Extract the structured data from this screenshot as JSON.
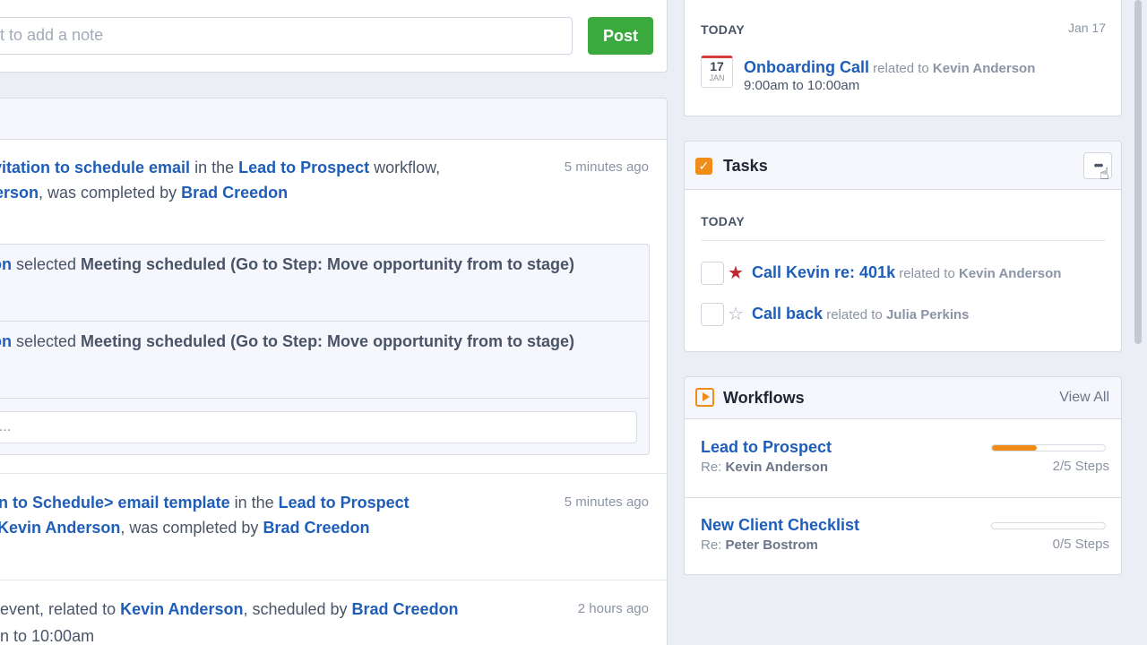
{
  "composer": {
    "placeholder_text": "ct to add a note",
    "post_label": "Post"
  },
  "feed": {
    "entry1": {
      "line1": {
        "link1": "vitation to schedule email",
        "text1": " in the ",
        "link2": "Lead to Prospect",
        "text2": " workflow,"
      },
      "line2": {
        "link1": "erson",
        "text1": ", was completed by ",
        "link2": "Brad Creedon"
      },
      "time": "5 minutes ago"
    },
    "sub_rows": [
      {
        "link": "on",
        "text": " selected ",
        "bold": "Meeting scheduled (Go to Step: Move opportunity from to stage)"
      },
      {
        "link": "on",
        "text": " selected ",
        "bold": "Meeting scheduled (Go to Step: Move opportunity from to stage)"
      }
    ],
    "reply_placeholder": "y...",
    "entry2": {
      "line1": {
        "link1": "n to Schedule> email template",
        "text1": " in the ",
        "link2": "Lead to Prospect"
      },
      "line2": {
        "link1": "Kevin Anderson",
        "text1": ", was completed by ",
        "link2": "Brad Creedon"
      },
      "time": "5 minutes ago"
    },
    "entry3": {
      "line1": {
        "text0": " event, related to ",
        "link1": "Kevin Anderson",
        "text1": ", scheduled by ",
        "link2": "Brad Creedon"
      },
      "line2": {
        "text0": "n to 10:00am"
      },
      "time": "2 hours ago"
    }
  },
  "calendar": {
    "section": "TODAY",
    "date": "Jan 17",
    "icon_day": "17",
    "icon_month": "JAN",
    "event_title": "Onboarding Call",
    "related_prefix": " related to ",
    "related_name": "Kevin Anderson",
    "event_time": "9:00am to 10:00am"
  },
  "tasks": {
    "title": "Tasks",
    "section": "TODAY",
    "items": [
      {
        "title": "Call Kevin re: 401k",
        "related_prefix": " related to ",
        "related_name": "Kevin Anderson",
        "starred": true
      },
      {
        "title": "Call back",
        "related_prefix": " related to ",
        "related_name": "Julia Perkins",
        "starred": false
      }
    ]
  },
  "workflows": {
    "title": "Workflows",
    "view_all": "View All",
    "items": [
      {
        "name": "Lead to Prospect",
        "re_prefix": "Re: ",
        "re_name": "Kevin Anderson",
        "steps": "2/5 Steps",
        "progress": 0.4
      },
      {
        "name": "New Client Checklist",
        "re_prefix": "Re: ",
        "re_name": "Peter Bostrom",
        "steps": "0/5 Steps",
        "progress": 0
      }
    ]
  },
  "colors": {
    "accent_blue": "#1f5eb8",
    "post_green": "#3aaa3f",
    "orange": "#f08c18",
    "star_red": "#c0262d"
  }
}
